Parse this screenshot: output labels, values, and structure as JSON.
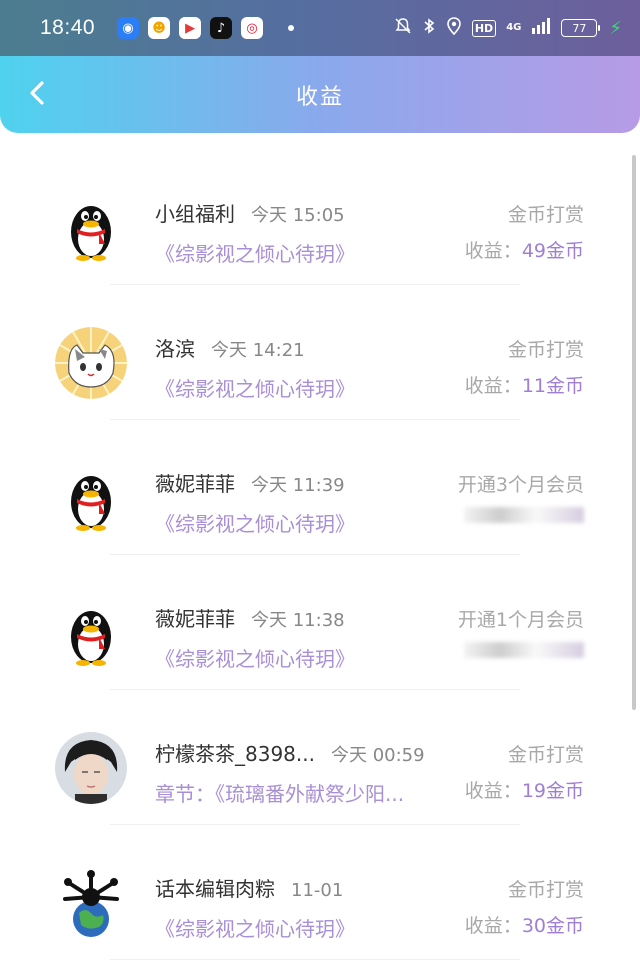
{
  "status_bar": {
    "time": "18:40",
    "apps": [
      {
        "icon": "maps-app-icon",
        "glyph": "◉",
        "bg": "#2b7ef6",
        "fg": "#ffffff"
      },
      {
        "icon": "photo-app-icon",
        "glyph": "☻",
        "bg": "#ffffff",
        "fg": "#f0a400"
      },
      {
        "icon": "video-app-icon",
        "glyph": "▶",
        "bg": "#ffffff",
        "fg": "#e23b3b"
      },
      {
        "icon": "tiktok-app-icon",
        "glyph": "♪",
        "bg": "#111111",
        "fg": "#ffffff"
      },
      {
        "icon": "weibo-app-icon",
        "glyph": "◎",
        "bg": "#ffffff",
        "fg": "#e6162d"
      }
    ],
    "hd_label": "HD",
    "network_label": "4G",
    "battery_level": "77"
  },
  "header": {
    "title": "收益",
    "back_icon": "chevron-left-icon"
  },
  "income_list": [
    {
      "name": "小组福利",
      "time": "今天 15:05",
      "subtitle": "《综影视之倾心待玥》",
      "type": "金币打赏",
      "earnings_label": "收益：",
      "earnings_amount": "49金币",
      "avatar": "penguin",
      "hidden": false
    },
    {
      "name": "洛滨",
      "time": "今天 14:21",
      "subtitle": "《综影视之倾心待玥》",
      "type": "金币打赏",
      "earnings_label": "收益：",
      "earnings_amount": "11金币",
      "avatar": "cat",
      "hidden": false
    },
    {
      "name": "薇妮菲菲",
      "time": "今天 11:39",
      "subtitle": "《综影视之倾心待玥》",
      "type": "开通3个月会员",
      "earnings_label": "",
      "earnings_amount": "",
      "avatar": "penguin",
      "hidden": true
    },
    {
      "name": "薇妮菲菲",
      "time": "今天 11:38",
      "subtitle": "《综影视之倾心待玥》",
      "type": "开通1个月会员",
      "earnings_label": "",
      "earnings_amount": "",
      "avatar": "penguin",
      "hidden": true
    },
    {
      "name": "柠檬茶茶_8398...",
      "time": "今天 00:59",
      "subtitle": "章节：《琉璃番外献祭少阳...",
      "type": "金币打赏",
      "earnings_label": "收益：",
      "earnings_amount": "19金币",
      "avatar": "portrait",
      "hidden": false
    },
    {
      "name": "话本编辑肉粽",
      "time": "11-01",
      "subtitle": "《综影视之倾心待玥》",
      "type": "金币打赏",
      "earnings_label": "收益：",
      "earnings_amount": "30金币",
      "avatar": "earth",
      "hidden": false
    }
  ],
  "colors": {
    "accent": "#a98fd6",
    "header_start": "#4fd2ee",
    "header_end": "#b79be6"
  }
}
